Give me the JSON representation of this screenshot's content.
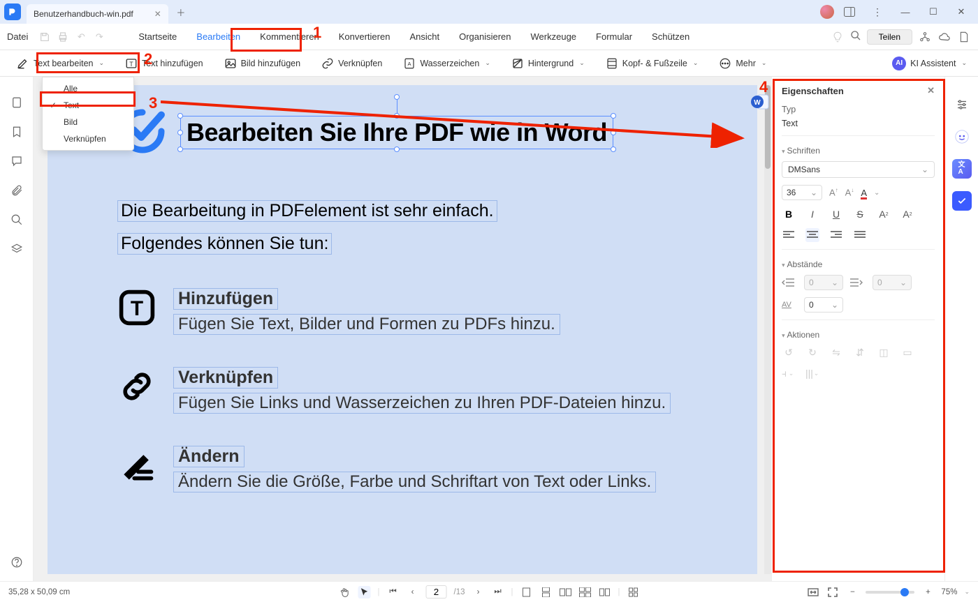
{
  "titlebar": {
    "tab_title": "Benutzerhandbuch-win.pdf"
  },
  "menubar": {
    "file_label": "Datei",
    "items": [
      "Startseite",
      "Bearbeiten",
      "Kommentieren",
      "Konvertieren",
      "Ansicht",
      "Organisieren",
      "Werkzeuge",
      "Formular",
      "Schützen"
    ],
    "share_label": "Teilen"
  },
  "toolbar": {
    "edit_text": "Text bearbeiten",
    "add_text": "Text hinzufügen",
    "add_image": "Bild hinzufügen",
    "link": "Verknüpfen",
    "watermark": "Wasserzeichen",
    "background": "Hintergrund",
    "header_footer": "Kopf- & Fußzeile",
    "more": "Mehr",
    "ki_badge": "AI",
    "ki_assistant": "KI Assistent"
  },
  "edit_dropdown": {
    "items": [
      {
        "label": "Alle",
        "checked": false
      },
      {
        "label": "Text",
        "checked": true
      },
      {
        "label": "Bild",
        "checked": false
      },
      {
        "label": "Verknüpfen",
        "checked": false
      }
    ]
  },
  "document": {
    "heading": "Bearbeiten Sie Ihre PDF wie in Word",
    "intro1": "Die Bearbeitung in PDFelement ist sehr einfach.",
    "intro2": "Folgendes können Sie tun:",
    "features": [
      {
        "title": "Hinzufügen",
        "desc": "Fügen Sie Text, Bilder und Formen zu PDFs hinzu."
      },
      {
        "title": "Verknüpfen",
        "desc": "Fügen Sie Links und Wasserzeichen zu Ihren PDF-Dateien hinzu."
      },
      {
        "title": "Ändern",
        "desc": "Ändern Sie die Größe, Farbe und Schriftart von Text oder Links."
      }
    ]
  },
  "properties": {
    "panel_title": "Eigenschaften",
    "type_label": "Typ",
    "type_value": "Text",
    "fonts_label": "Schriften",
    "font_family": "DMSans",
    "font_size": "36",
    "spacing_label": "Abstände",
    "indent_left": "0",
    "indent_right": "0",
    "letter_spacing": "0",
    "actions_label": "Aktionen"
  },
  "statusbar": {
    "dimensions": "35,28 x 50,09 cm",
    "page_current": "2",
    "page_total": "/13",
    "zoom": "75%"
  },
  "annotations": {
    "a1": "1",
    "a2": "2",
    "a3": "3",
    "a4": "4"
  }
}
